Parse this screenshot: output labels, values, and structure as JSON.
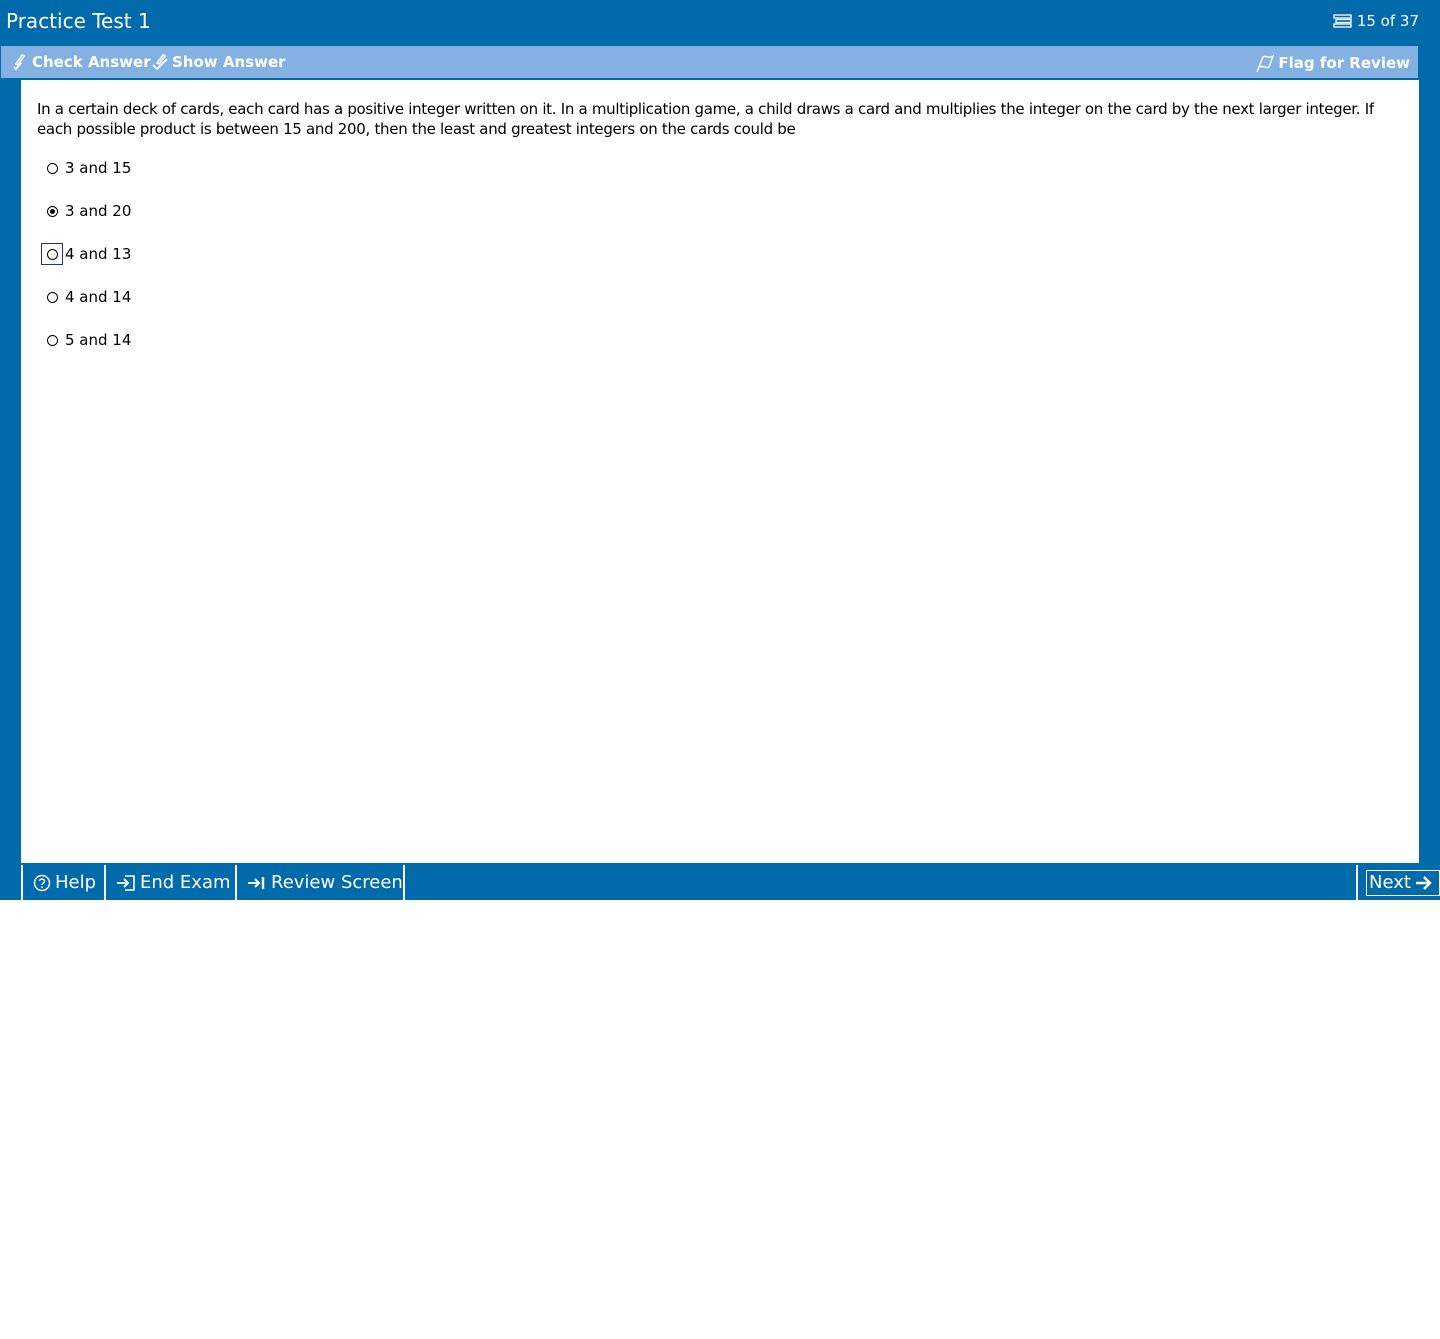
{
  "window": {
    "title": "Practice Test 1",
    "progress": "15 of 37"
  },
  "toolbar": {
    "check_answer": "Check Answer",
    "show_answer": "Show Answer",
    "flag_review": "Flag for Review"
  },
  "question": {
    "text": "In a certain deck of cards, each card has a positive integer written on it.  In a multiplication game, a child draws a card and multiplies the integer on the card by the next larger integer.  If each possible product is between 15 and 200, then the least and greatest integers on the cards could be",
    "options": [
      {
        "label": "3 and 15",
        "selected": false
      },
      {
        "label": "3 and 20",
        "selected": true
      },
      {
        "label": "4 and 13",
        "selected": false,
        "focused": true
      },
      {
        "label": "4 and 14",
        "selected": false
      },
      {
        "label": "5 and 14",
        "selected": false
      }
    ]
  },
  "bottombar": {
    "help": "Help",
    "end_exam": "End Exam",
    "review_screen": "Review Screen",
    "next": "Next"
  },
  "colors": {
    "primary": "#006aaa",
    "toolbar": "#84b0e2",
    "focus": "#1f2f9a"
  }
}
